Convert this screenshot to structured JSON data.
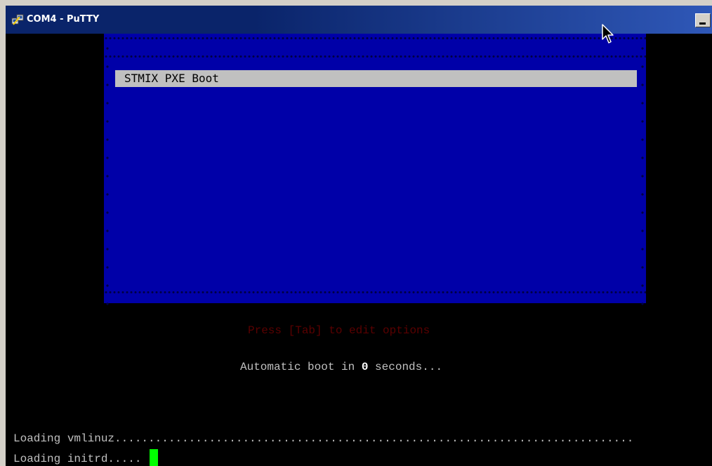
{
  "window": {
    "title": "COM4 - PuTTY",
    "title_icon": "putty-icon",
    "minimize_icon": "minimize-icon",
    "titlebar_color": "#0a246a"
  },
  "terminal": {
    "background": "#000000",
    "menu": {
      "background": "#0000a8",
      "selected_item": "STMIX PXE Boot",
      "selected_bg": "#c0c0c0"
    },
    "hint_text": "Press [Tab] to edit options",
    "hint_color": "#5a0000",
    "autoboot_prefix": "Automatic boot in ",
    "autoboot_seconds": "0",
    "autoboot_suffix": " seconds...",
    "loading_kernel": "Loading vmlinuz.............................................................................",
    "loading_initrd": "Loading initrd..... ",
    "cursor_color": "#00ff00"
  },
  "pointer_icon": "mouse-pointer-icon"
}
